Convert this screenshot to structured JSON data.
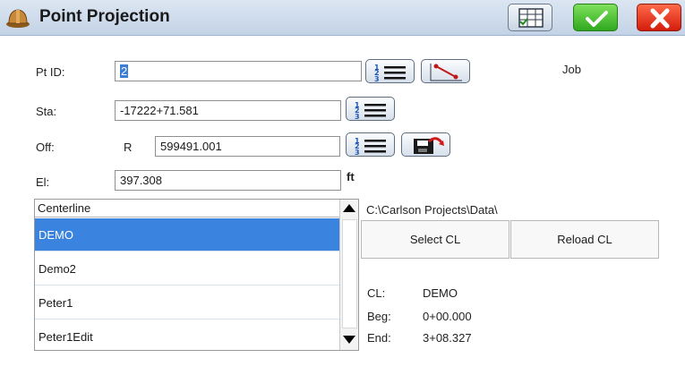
{
  "window": {
    "title": "Point Projection"
  },
  "form": {
    "pt_id": {
      "label": "Pt ID:",
      "value": "2"
    },
    "sta": {
      "label": "Sta:",
      "value": "-17222+71.581"
    },
    "off": {
      "label": "Off:",
      "side": "R",
      "value": "599491.001"
    },
    "el": {
      "label": "El:",
      "value": "397.308",
      "unit": "ft"
    },
    "job_label": "Job"
  },
  "centerline_list": {
    "header": "Centerline",
    "items": [
      "DEMO",
      "Demo2",
      "Peter1",
      "Peter1Edit"
    ],
    "selected_index": 0
  },
  "path": "C:\\Carlson Projects\\Data\\",
  "buttons": {
    "select_cl": "Select CL",
    "reload_cl": "Reload CL"
  },
  "info": {
    "cl_label": "CL:",
    "cl_value": "DEMO",
    "beg_label": "Beg:",
    "beg_value": "0+00.000",
    "end_label": "End:",
    "end_value": "3+08.327"
  },
  "colors": {
    "accent": "#3a84df",
    "ok_green": "#2fa81f",
    "cancel_red": "#d41c0c"
  }
}
